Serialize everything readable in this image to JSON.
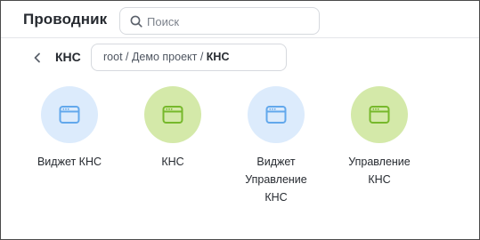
{
  "header": {
    "title": "Проводник",
    "search": {
      "placeholder": "Поиск",
      "value": ""
    }
  },
  "nav": {
    "current_folder": "КНС",
    "path": {
      "prefix": "root / Демо проект / ",
      "current": "КНС"
    }
  },
  "items": [
    {
      "label_lines": [
        "Виджет КНС"
      ],
      "icon": "window-icon",
      "variant": "widget",
      "circle_color": "#dcebfc",
      "icon_color": "#62a8ec"
    },
    {
      "label_lines": [
        "КНС"
      ],
      "icon": "window-icon",
      "variant": "app",
      "circle_color": "#d4e9a9",
      "icon_color": "#76b82b"
    },
    {
      "label_lines": [
        "Виджет",
        "Управление",
        "КНС"
      ],
      "icon": "window-icon",
      "variant": "widget",
      "circle_color": "#dcebfc",
      "icon_color": "#62a8ec"
    },
    {
      "label_lines": [
        "Управление",
        "КНС"
      ],
      "icon": "window-icon",
      "variant": "app",
      "circle_color": "#d4e9a9",
      "icon_color": "#76b82b"
    }
  ]
}
